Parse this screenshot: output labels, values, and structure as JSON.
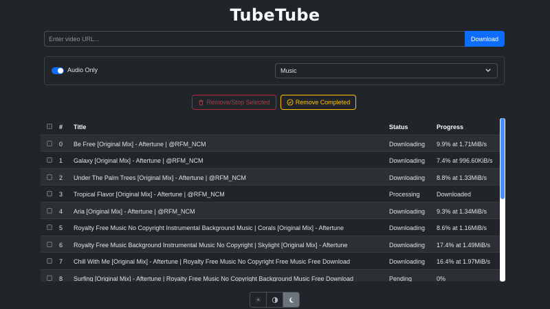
{
  "app": {
    "title": "TubeTube"
  },
  "url_bar": {
    "placeholder": "Enter video URL...",
    "button_label": "Download"
  },
  "options": {
    "audio_only_label": "Audio Only",
    "audio_only_enabled": true,
    "category_selected": "Music"
  },
  "actions": {
    "remove_stop_label": "Remove/Stop Selected",
    "remove_completed_label": "Remove Completed"
  },
  "table": {
    "headers": {
      "num": "#",
      "title": "Title",
      "status": "Status",
      "progress": "Progress"
    },
    "rows": [
      {
        "num": "0",
        "title": "Be Free [Original Mix] - Aftertune | @RFM_NCM",
        "status": "Downloading",
        "progress": "9.9% at 1.71MiB/s"
      },
      {
        "num": "1",
        "title": "Galaxy [Original Mix] - Aftertune | @RFM_NCM",
        "status": "Downloading",
        "progress": "7.4% at 996.60KiB/s"
      },
      {
        "num": "2",
        "title": "Under The Palm Trees [Original Mix] - Aftertune | @RFM_NCM",
        "status": "Downloading",
        "progress": "8.8% at 1.33MiB/s"
      },
      {
        "num": "3",
        "title": "Tropical Flavor [Original Mix] - Aftertune | @RFM_NCM",
        "status": "Processing",
        "progress": "Downloaded"
      },
      {
        "num": "4",
        "title": "Aria [Original Mix] - Aftertune | @RFM_NCM",
        "status": "Downloading",
        "progress": "9.3% at 1.34MiB/s"
      },
      {
        "num": "5",
        "title": "Royalty Free Music No Copyright Instrumental Background Music | Corals [Original Mix] - Aftertune",
        "status": "Downloading",
        "progress": "8.6% at 1.16MiB/s"
      },
      {
        "num": "6",
        "title": "Royalty Free Music Background Instrumental Music No Copyright | Skylight [Original Mix] - Aftertune",
        "status": "Downloading",
        "progress": "17.4% at 1.49MiB/s"
      },
      {
        "num": "7",
        "title": "Chill With Me [Original Mix] - Aftertune | Royalty Free Music No Copyright Free Music Free Download",
        "status": "Downloading",
        "progress": "16.4% at 1.97MiB/s"
      },
      {
        "num": "8",
        "title": "Surfing [Original Mix] - Aftertune | Royalty Free Music No Copyright Background Music Free Download",
        "status": "Pending",
        "progress": "0%"
      }
    ]
  },
  "theme": {
    "options": [
      "light",
      "auto",
      "dark"
    ],
    "selected": "dark"
  },
  "colors": {
    "primary": "#0d6efd",
    "danger": "#b02a37",
    "warning": "#ffc107",
    "background": "#212529"
  }
}
